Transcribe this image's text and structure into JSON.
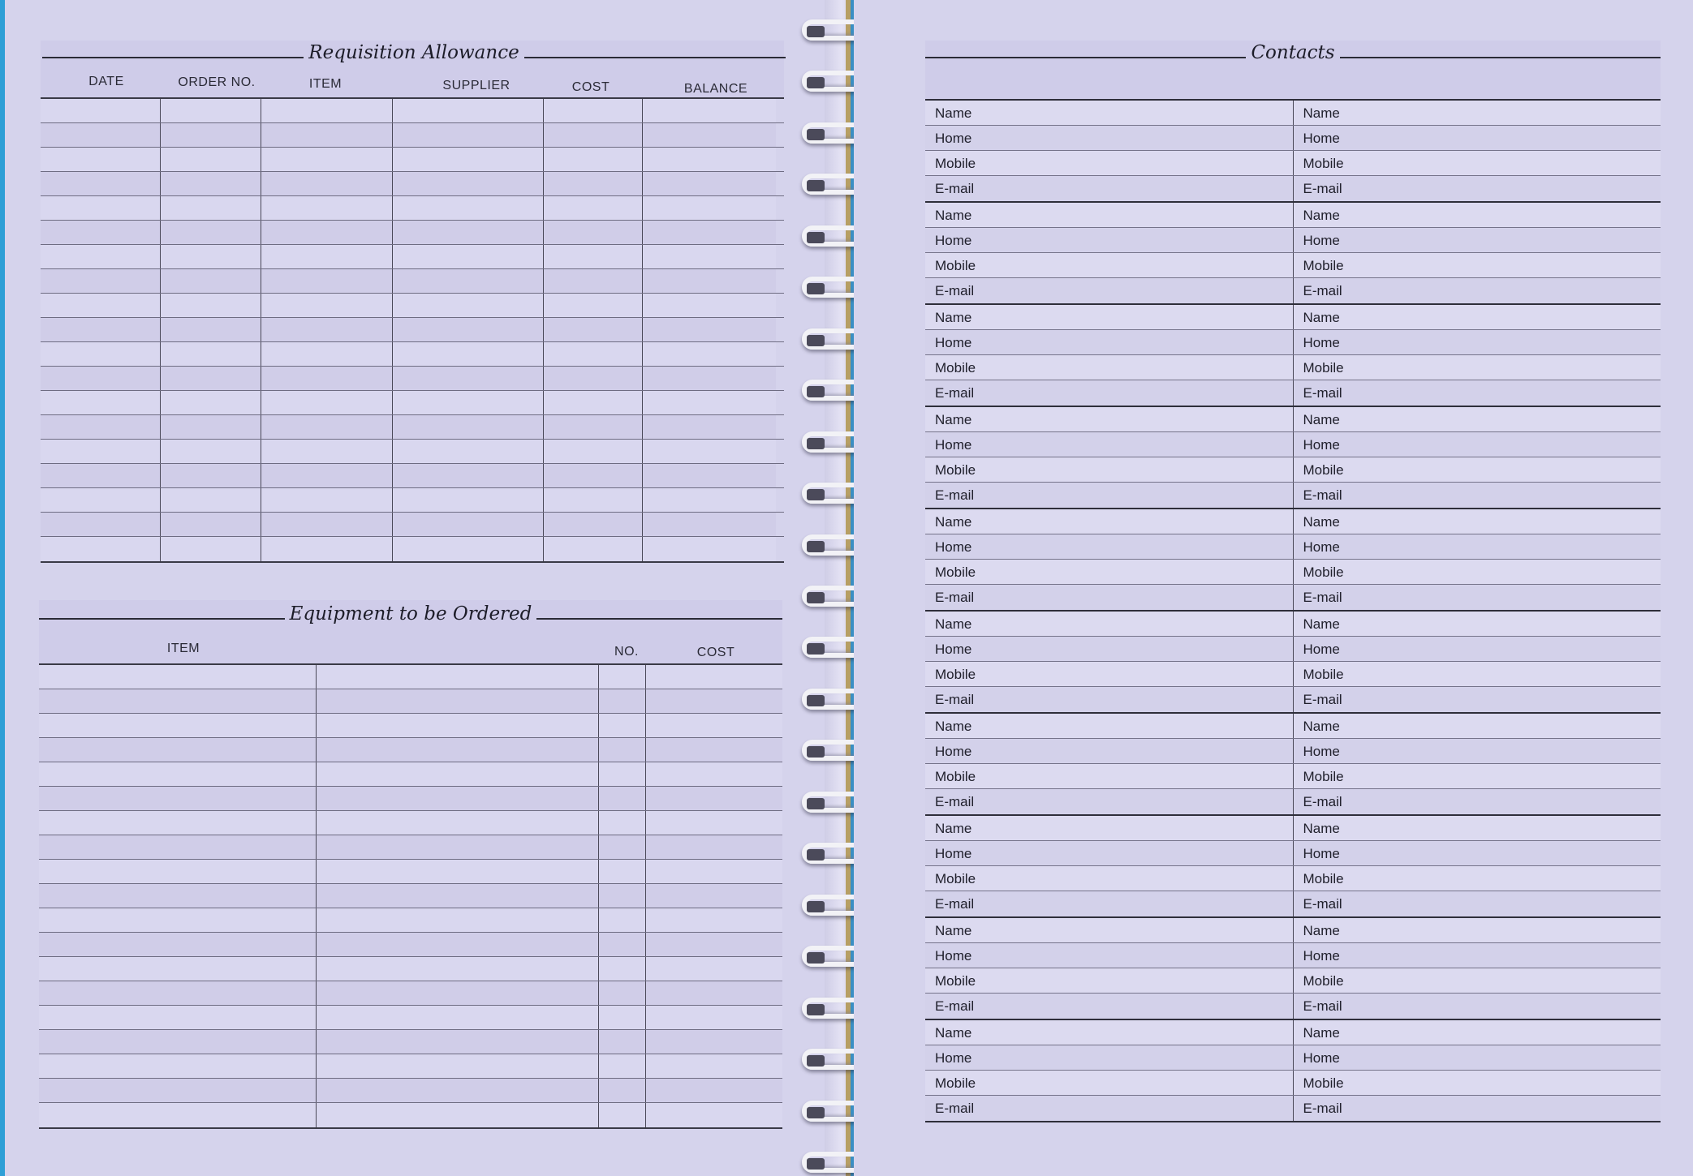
{
  "requisition": {
    "title": "Requisition Allowance",
    "columns": [
      "DATE",
      "ORDER NO.",
      "ITEM",
      "SUPPLIER",
      "COST",
      "BALANCE"
    ],
    "row_count": 19
  },
  "equipment": {
    "title": "Equipment to be Ordered",
    "columns": [
      "ITEM",
      "NO.",
      "COST"
    ],
    "row_count": 19
  },
  "contacts": {
    "title": "Contacts",
    "field_labels": [
      "Name",
      "Home",
      "Mobile",
      "E-mail"
    ],
    "group_count": 10
  },
  "binding": {
    "ring_count": 23
  },
  "colors": {
    "background": "#2e9fd6",
    "paper": "#d5d3ec",
    "ink": "#1e1e2a",
    "ring": "#f2f2f6"
  }
}
